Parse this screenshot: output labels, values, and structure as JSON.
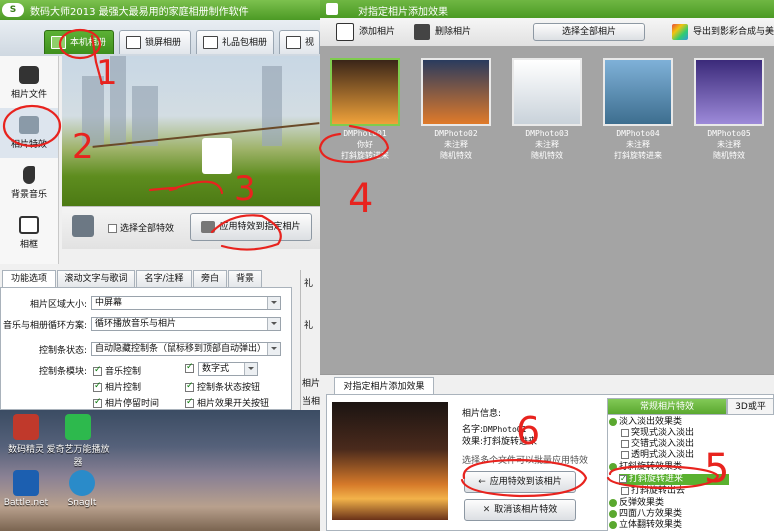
{
  "left_window": {
    "title": "数码大师2013  最强大最易用的家庭相册制作软件",
    "logo_text": "S",
    "top_tabs": [
      {
        "label": "本机相册",
        "active": true
      },
      {
        "label": "锁屏相册",
        "active": false
      },
      {
        "label": "礼品包相册",
        "active": false
      },
      {
        "label": "视",
        "active": false
      }
    ],
    "side_items": [
      {
        "label": "相片文件",
        "icon": "camera-icon"
      },
      {
        "label": "相片特效",
        "icon": "sparkle-icon",
        "selected": true
      },
      {
        "label": "背景音乐",
        "icon": "music-note-icon"
      },
      {
        "label": "相框",
        "icon": "picture-frame-icon"
      }
    ],
    "preview_toolbar": {
      "select_all_effects_label": "选择全部特效",
      "apply_effect_button": "应用特效到指定相片"
    },
    "option_tabs": [
      "功能选项",
      "滚动文字与歌词",
      "名字/注释",
      "旁白",
      "背景"
    ],
    "options": {
      "area_size_label": "相片区域大小:",
      "area_size_value": "中屏幕",
      "loop_label": "音乐与相册循环方案:",
      "loop_value": "循环播放音乐与相片",
      "ctrlbar_state_label": "控制条状态:",
      "ctrlbar_state_value": "自动隐藏控制条（鼠标移到顶部自动弹出）",
      "ctrlbar_module_label": "控制条模块:",
      "modules": [
        {
          "label": "音乐控制",
          "checked": true
        },
        {
          "label": "数字式",
          "checked": true,
          "is_select": true
        },
        {
          "label": "相片控制",
          "checked": true
        },
        {
          "label": "控制条状态按钮",
          "checked": true
        },
        {
          "label": "相片停留时间",
          "checked": true
        },
        {
          "label": "相片效果开关按钮",
          "checked": true
        }
      ]
    },
    "right_strip": [
      "礼",
      "礼",
      "相片",
      "当相"
    ]
  },
  "desktop_icons": [
    {
      "label": "爱奇艺万能播放器",
      "short": "爱奇艺万能",
      "color": "#2db94d"
    },
    {
      "label": "Battle.net",
      "color": "#1c5fb0"
    },
    {
      "label": "SnagIt",
      "color": "#2a8bc9"
    },
    {
      "label": "数码精灵",
      "color": "#c0392b"
    }
  ],
  "right_window": {
    "title": "对指定相片添加效果",
    "toolbar": {
      "add_photo": "添加相片",
      "delete_photo": "删除相片",
      "select_all_photos": "选择全部相片",
      "export": "导出到影彩合成与美"
    },
    "photos": [
      {
        "name": "DMPhoto01",
        "note": "你好",
        "effect": "打斜旋转进来",
        "selected": true,
        "colors": [
          "#3a2518",
          "#f0a23a"
        ]
      },
      {
        "name": "DMPhoto02",
        "note": "未注释",
        "effect": "随机特效",
        "selected": false,
        "colors": [
          "#2a3b5e",
          "#e07a2a"
        ]
      },
      {
        "name": "DMPhoto03",
        "note": "未注释",
        "effect": "随机特效",
        "selected": false,
        "colors": [
          "#ffffff",
          "#c9d2da"
        ]
      },
      {
        "name": "DMPhoto04",
        "note": "未注释",
        "effect": "打斜旋转进来",
        "selected": false,
        "colors": [
          "#7fb1d8",
          "#3d6e8f"
        ]
      },
      {
        "name": "DMPhoto05",
        "note": "未注释",
        "effect": "随机特效",
        "selected": false,
        "colors": [
          "#3b2a7a",
          "#9d8ad9"
        ]
      }
    ],
    "bottom": {
      "tab": "对指定相片添加效果",
      "info_title": "相片信息:",
      "name_label": "名字:",
      "name_value": "DMPhoto01",
      "effect_label": "效果:",
      "effect_value": "打斜旋转进来",
      "hint": "选择多个文件可以批量应用特效",
      "apply_button": "应用特效到该相片",
      "cancel_button": "取消该相片特效"
    },
    "effects_panel": {
      "tabs": [
        "常规相片特效",
        "3D或平"
      ],
      "tree": [
        {
          "label": "淡入淡出效果类",
          "type": "group",
          "level": 0
        },
        {
          "label": "突现式淡入淡出",
          "type": "item",
          "level": 1,
          "checked": false
        },
        {
          "label": "交错式淡入淡出",
          "type": "item",
          "level": 1,
          "checked": false
        },
        {
          "label": "透明式淡入淡出",
          "type": "item",
          "level": 1,
          "checked": false
        },
        {
          "label": "打斜旋转效果类",
          "type": "group",
          "level": 0
        },
        {
          "label": "打斜旋转进来",
          "type": "item",
          "level": 1,
          "checked": true,
          "highlight": true
        },
        {
          "label": "打斜旋转出去",
          "type": "item",
          "level": 1,
          "checked": false
        },
        {
          "label": "反弹效果类",
          "type": "group",
          "level": 0
        },
        {
          "label": "四面八方效果类",
          "type": "group",
          "level": 0
        },
        {
          "label": "立体翻转效果类",
          "type": "group",
          "level": 0
        }
      ]
    }
  },
  "annotations": [
    "1",
    "2",
    "3",
    "4",
    "5",
    "6"
  ]
}
